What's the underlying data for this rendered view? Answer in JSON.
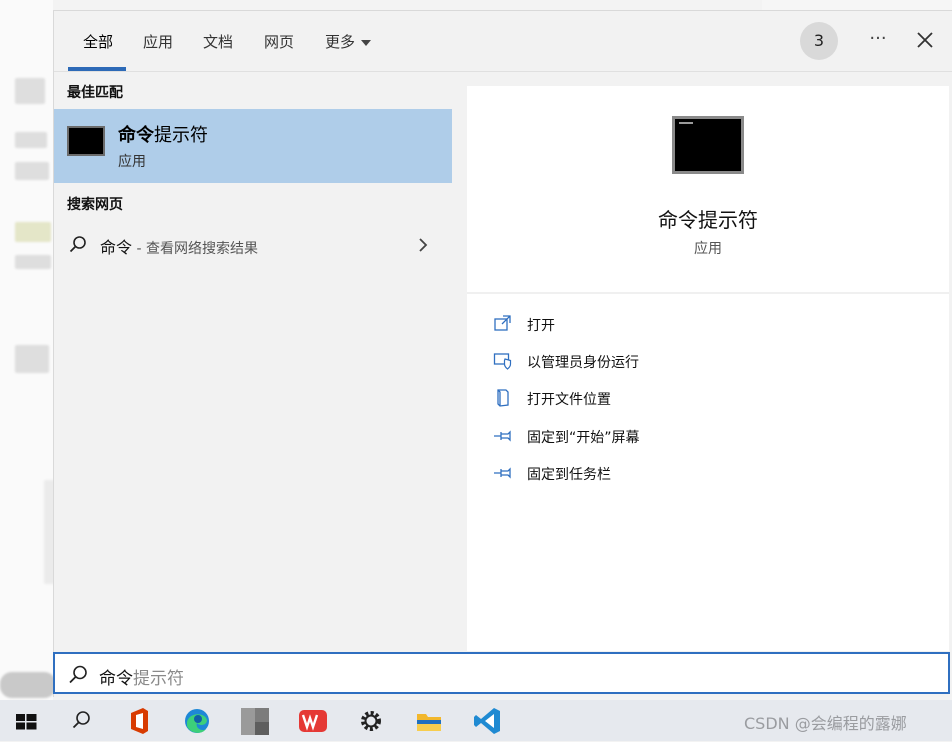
{
  "tabs": [
    {
      "label": "全部",
      "active": true
    },
    {
      "label": "应用"
    },
    {
      "label": "文档"
    },
    {
      "label": "网页"
    },
    {
      "label": "更多"
    }
  ],
  "header": {
    "badge": "3",
    "more_icon": "ellipsis-icon",
    "close_icon": "close-icon"
  },
  "best_match": {
    "section_label": "最佳匹配",
    "title_bold": "命令",
    "title_rest": "提示符",
    "subtitle": "应用"
  },
  "web": {
    "section_label": "搜索网页",
    "query": "命令",
    "hint": " - 查看网络搜索结果"
  },
  "detail": {
    "title": "命令提示符",
    "subtitle": "应用",
    "actions": [
      {
        "label": "打开",
        "icon": "open-icon"
      },
      {
        "label": "以管理员身份运行",
        "icon": "shield-icon"
      },
      {
        "label": "打开文件位置",
        "icon": "file-location-icon"
      },
      {
        "label": "固定到“开始”屏幕",
        "icon": "pin-icon"
      },
      {
        "label": "固定到任务栏",
        "icon": "pin-icon"
      }
    ]
  },
  "search": {
    "typed": "命令",
    "suggestion": "提示符"
  },
  "taskbar": {
    "items": [
      "windows-start-icon",
      "search-icon",
      "office-icon",
      "edge-icon",
      "app-icon",
      "wps-icon",
      "settings-icon",
      "file-explorer-icon",
      "vscode-icon"
    ],
    "watermark": "CSDN @会编程的露娜"
  },
  "colors": {
    "accent": "#2d6ab7",
    "selected_bg": "#afcde9",
    "action_icon": "#2f6fc0"
  }
}
